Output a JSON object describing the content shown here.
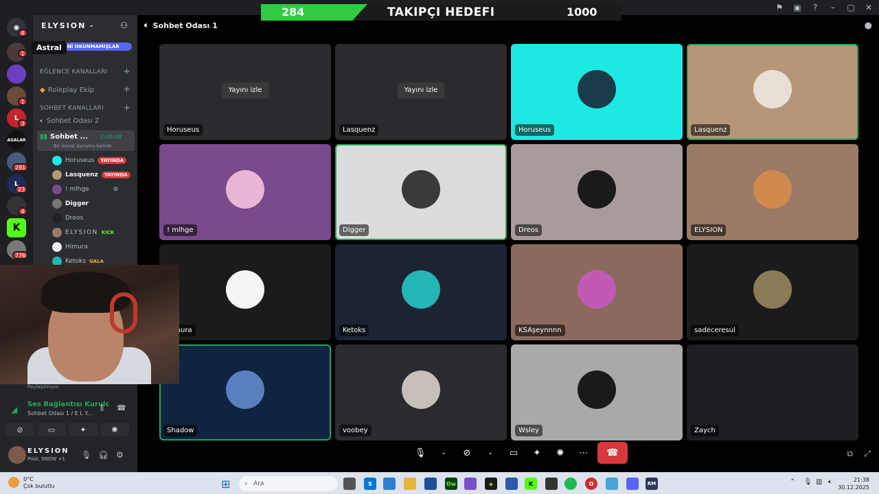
{
  "goal": {
    "current": "284",
    "title": "TAKIPÇI HEDEFI",
    "target": "1000"
  },
  "rail": {
    "tooltip": "Astral",
    "badges": [
      "4",
      "1",
      "1",
      "3",
      "291",
      "23",
      "4",
      "776"
    ],
    "agalar": "AGALAR"
  },
  "sidebar": {
    "server_name": "ELYSION",
    "unread_label": "YENİ OKUNMAMIŞLAR",
    "cat_fun": "EĞLENCE KANALLARI",
    "chan_roleplay": "Roleplay Ekip",
    "cat_chat": "SOHBET KANALLARI",
    "chan_chat2": "Sohbet Odası 2",
    "active_channel": "Sohbet ...",
    "active_timer": "2:00:48",
    "active_status": "Bir kanal durumu belirle",
    "users": [
      {
        "name": "Horuseus",
        "badge": "YAYINDA"
      },
      {
        "name": "Lasquenz",
        "badge": "YAYINDA"
      },
      {
        "name": "! mlhge",
        "badge": ""
      },
      {
        "name": "Digger",
        "badge": ""
      },
      {
        "name": "Dreos",
        "badge": ""
      },
      {
        "name": "ELYSION",
        "badge": "KICK"
      },
      {
        "name": "Himura",
        "badge": ""
      },
      {
        "name": "Ketoks",
        "badge": "GALA"
      }
    ]
  },
  "voice_panel": {
    "share": "Paylaşılmıyor",
    "connection": "Ses Bağlantısı Kurulc",
    "location": "Sohbet Odası 1 / E L Y...",
    "user_name": "ELYSION",
    "user_status": "Poizi, SNOW +1"
  },
  "stage": {
    "channel_name": "Sohbet Odası 1",
    "watch_label": "Yayını izle",
    "tiles": [
      {
        "name": "Horuseus",
        "bg": "#2a2b2f",
        "av": "none",
        "stream": true
      },
      {
        "name": "Lasquenz",
        "bg": "#2a2b2f",
        "av": "none",
        "stream": true
      },
      {
        "name": "Horuseus",
        "bg": "#1de9e3",
        "av": "#1a3b4a",
        "stream": false
      },
      {
        "name": "Lasquenz",
        "bg": "#b59676",
        "av": "#e8e0d6",
        "stream": false,
        "speaking": true
      },
      {
        "name": "! mlhge",
        "bg": "#7b4a8c",
        "av": "#e9b7d5",
        "stream": false
      },
      {
        "name": "Digger",
        "bg": "#dcdcdc",
        "av": "#3a3a3a",
        "stream": false,
        "speaking": true
      },
      {
        "name": "Dreos",
        "bg": "#a89b9b",
        "av": "#1a1a1a",
        "stream": false
      },
      {
        "name": "ELYSION",
        "bg": "#9a7b66",
        "av": "#d08a4e",
        "stream": false
      },
      {
        "name": "Himura",
        "bg": "#1b1b1d",
        "av": "#f5f5f5",
        "stream": false
      },
      {
        "name": "Ketoks",
        "bg": "#1c2434",
        "av": "#24b5b5",
        "stream": false
      },
      {
        "name": "KSAşeynnnn",
        "bg": "#8a6a5c",
        "av": "#c15ab5",
        "stream": false
      },
      {
        "name": "sadeceresul",
        "bg": "#1b1b1d",
        "av": "#8a7a55",
        "stream": false
      },
      {
        "name": "Shadow",
        "bg": "#0e2440",
        "av": "#5a7fc0",
        "stream": false,
        "speaking": true
      },
      {
        "name": "voobey",
        "bg": "#2a2b2f",
        "av": "#c6c0b8",
        "stream": false
      },
      {
        "name": "Wsley",
        "bg": "#a9a9a9",
        "av": "#1a1a1a",
        "stream": false
      },
      {
        "name": "Zaych",
        "bg": "#1e1f22",
        "av": "none",
        "stream": false
      }
    ]
  },
  "taskbar": {
    "temp": "0°C",
    "weather": "Çok bulutlu",
    "search_placeholder": "Ara",
    "time": "21:38",
    "date": "30.12.2025"
  }
}
